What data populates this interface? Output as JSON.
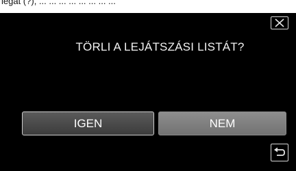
{
  "caption": {
    "text": "legat (?), ... ...   ...  ...  ...  ... ... ..."
  },
  "dialog": {
    "prompt": "TÖRLI A LEJÁTSZÁSI LISTÁT?",
    "yes_label": "IGEN",
    "no_label": "NEM",
    "close_icon": "close-icon",
    "back_icon": "return-arrow-icon"
  },
  "colors": {
    "screen_background": "#000000",
    "yes_button": "#4a4a4a",
    "no_button": "#7f7f7f",
    "text": "#ffffff"
  }
}
